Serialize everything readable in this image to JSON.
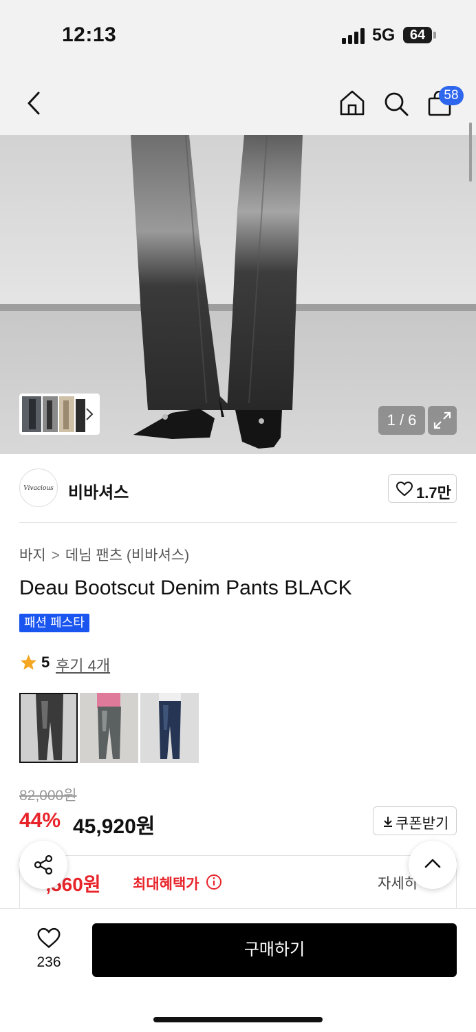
{
  "status_bar": {
    "time": "12:13",
    "network": "5G",
    "battery": "64"
  },
  "nav": {
    "cart_count": "58"
  },
  "gallery": {
    "counter": "1 / 6"
  },
  "brand": {
    "logo_text": "Vivacious",
    "name": "비바셔스",
    "likes": "1.7만"
  },
  "breadcrumb": {
    "category": "바지",
    "separator": ">",
    "subcategory": "데님 팬츠 (비바셔스)"
  },
  "product": {
    "title": "Deau Bootscut Denim Pants BLACK",
    "badge": "패션 페스타",
    "rating": "5",
    "review_link": "후기 4개",
    "variants": [
      "black wash",
      "dark grey wash",
      "indigo wash"
    ]
  },
  "price": {
    "original": "82,000원",
    "discount": "44%",
    "sale": "45,920원",
    "coupon_label": "쿠폰받기",
    "max_benefit_price": "-,560원",
    "max_benefit_label": "최대혜택가",
    "detail": "자세히"
  },
  "bottom": {
    "wish_count": "236",
    "buy_label": "구매하기"
  },
  "colors": {
    "accent_blue": "#2f66ee",
    "sale_red": "#e8242b",
    "buy_black": "#000000",
    "rating_star": "#f5a623"
  }
}
